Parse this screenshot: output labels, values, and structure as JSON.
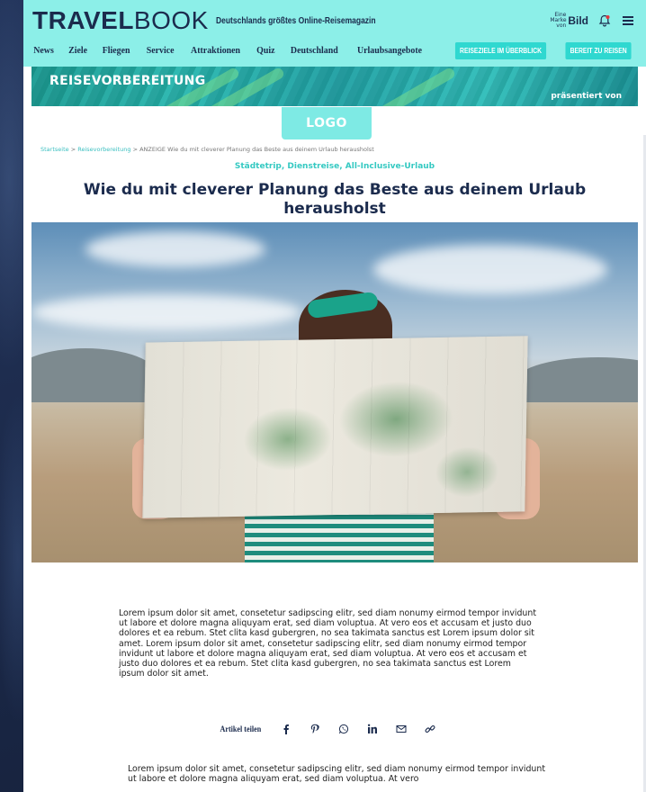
{
  "header": {
    "brand_bold": "TRAVEL",
    "brand_light": "BOOK",
    "tagline": "Deutschlands größtes Online-Reisemagazin",
    "partner_small": "Eine Marke von",
    "partner_brand": "Bild",
    "nav": [
      "News",
      "Ziele",
      "Fliegen",
      "Service",
      "Attraktionen",
      "Quiz",
      "Deutschland",
      "Urlaubsangebote"
    ],
    "buttons": [
      "REISEZIELE IM ÜBERBLICK",
      "BEREIT ZU REISEN"
    ]
  },
  "banner": {
    "title": "REISEVORBEREITUNG",
    "subtitle": "präsentiert von"
  },
  "sponsor": {
    "logo_text": "LOGO"
  },
  "breadcrumb": {
    "items": [
      "Startseite",
      "Reisevorbereitung"
    ],
    "current": "ANZEIGE Wie du mit cleverer Planung das Beste aus deinem Urlaub herausholst",
    "separator": " > "
  },
  "article": {
    "kicker": "Städtetrip, Dienstreise, All-Inclusive-Urlaub",
    "title": "Wie du mit cleverer Planung das Beste aus deinem Urlaub herausholst",
    "paragraph1": "Lorem ipsum dolor sit amet, consetetur sadipscing elitr, sed diam nonumy eirmod tempor invidunt ut labore et dolore magna aliquyam erat, sed diam voluptua. At vero eos et accusam et justo duo dolores et ea rebum. Stet clita kasd gubergren, no sea takimata sanctus est Lorem ipsum dolor sit amet. Lorem ipsum dolor sit amet, consetetur sadipscing elitr, sed diam nonumy eirmod tempor invidunt ut labore et dolore magna aliquyam erat, sed diam voluptua. At vero eos et accusam et justo duo dolores et ea rebum. Stet clita kasd gubergren, no sea takimata sanctus est Lorem ipsum dolor sit amet.",
    "paragraph2": "Lorem ipsum dolor sit amet, consetetur sadipscing elitr, sed diam nonumy eirmod tempor invidunt ut labore et dolore magna aliquyam erat, sed diam voluptua. At vero"
  },
  "share": {
    "label": "Artikel teilen",
    "icons": [
      "facebook-icon",
      "pinterest-icon",
      "whatsapp-icon",
      "linkedin-icon",
      "email-icon",
      "link-icon"
    ]
  },
  "colors": {
    "header_bg": "#8cefe8",
    "accent": "#2fd8d0",
    "navy": "#1b2b4d"
  }
}
